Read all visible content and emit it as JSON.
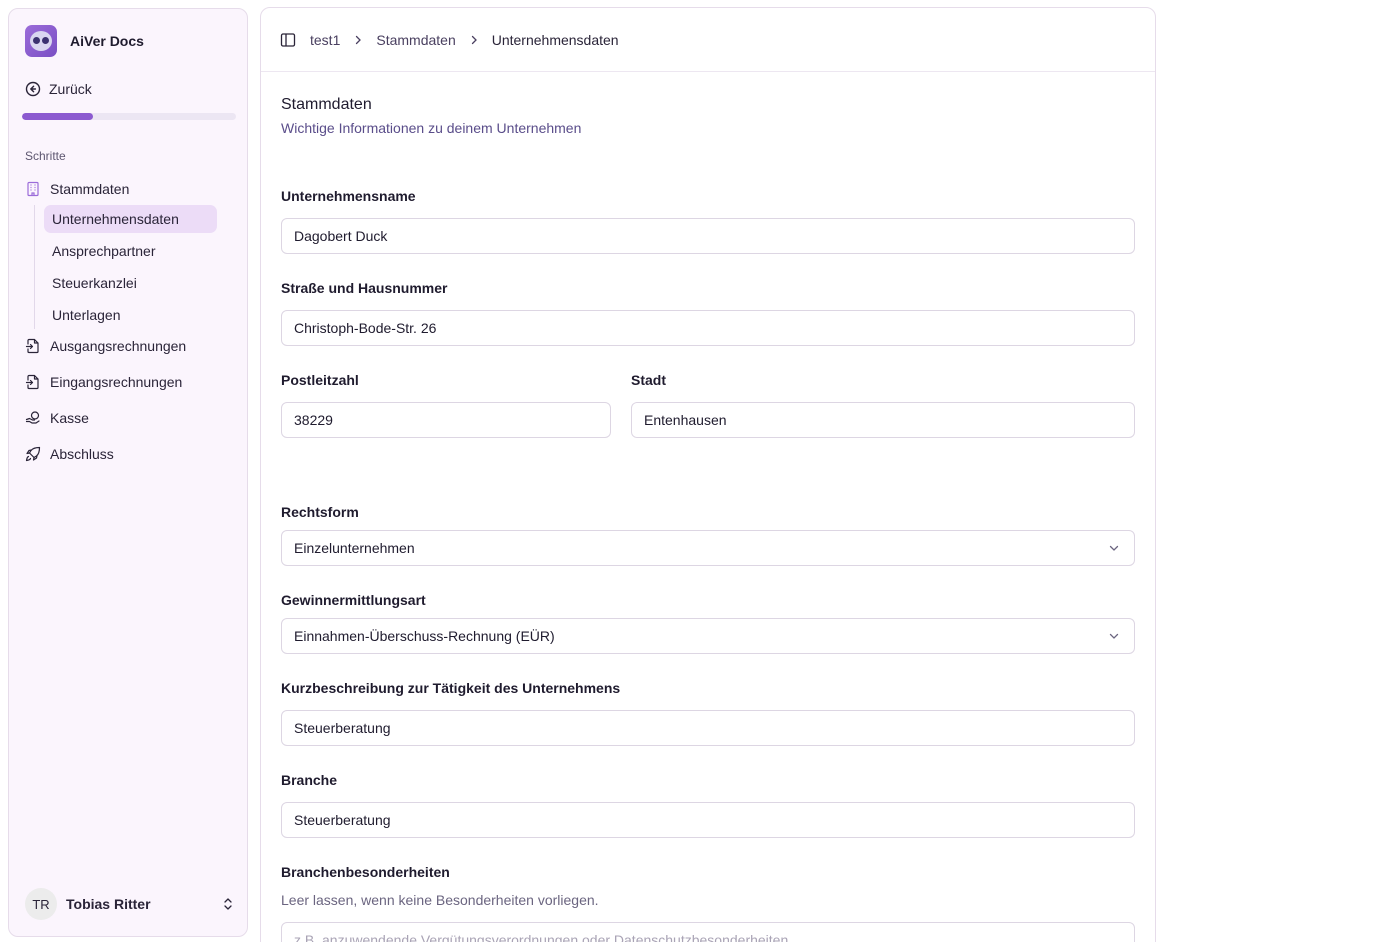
{
  "app": {
    "name": "AiVer Docs"
  },
  "sidebar": {
    "back_label": "Zurück",
    "progress": 0.33,
    "section_label": "Schritte",
    "items": [
      {
        "label": "Stammdaten",
        "icon": "building-icon"
      },
      {
        "label": "Ausgangsrechnungen",
        "icon": "file-export-icon"
      },
      {
        "label": "Eingangsrechnungen",
        "icon": "file-import-icon"
      },
      {
        "label": "Kasse",
        "icon": "cash-icon"
      },
      {
        "label": "Abschluss",
        "icon": "rocket-icon"
      }
    ],
    "sub_items": [
      {
        "label": "Unternehmensdaten",
        "active": true
      },
      {
        "label": "Ansprechpartner"
      },
      {
        "label": "Steuerkanzlei"
      },
      {
        "label": "Unterlagen"
      }
    ],
    "user": {
      "initials": "TR",
      "name": "Tobias Ritter"
    }
  },
  "breadcrumb": [
    "test1",
    "Stammdaten",
    "Unternehmensdaten"
  ],
  "form": {
    "title": "Stammdaten",
    "subtitle": "Wichtige Informationen zu deinem Unternehmen",
    "company_name": {
      "label": "Unternehmensname",
      "value": "Dagobert Duck"
    },
    "street": {
      "label": "Straße und Hausnummer",
      "value": "Christoph-Bode-Str. 26"
    },
    "zip": {
      "label": "Postleitzahl",
      "value": "38229"
    },
    "city": {
      "label": "Stadt",
      "value": "Entenhausen"
    },
    "legal_form": {
      "label": "Rechtsform",
      "value": "Einzelunternehmen"
    },
    "profit_method": {
      "label": "Gewinnermittlungsart",
      "value": "Einnahmen-Überschuss-Rechnung (EÜR)"
    },
    "activity": {
      "label": "Kurzbeschreibung zur Tätigkeit des Unternehmens",
      "value": "Steuerberatung"
    },
    "industry": {
      "label": "Branche",
      "value": "Steuerberatung"
    },
    "industry_specifics": {
      "label": "Branchenbesonderheiten",
      "help": "Leer lassen, wenn keine Besonderheiten vorliegen.",
      "placeholder": "z.B. anzuwendende Vergütungsverordnungen oder Datenschutzbesonderheiten"
    }
  },
  "colors": {
    "accent": "#8c5ad0",
    "active_bg": "#ecdcf7",
    "sidebar_bg": "#fbf5fd"
  }
}
